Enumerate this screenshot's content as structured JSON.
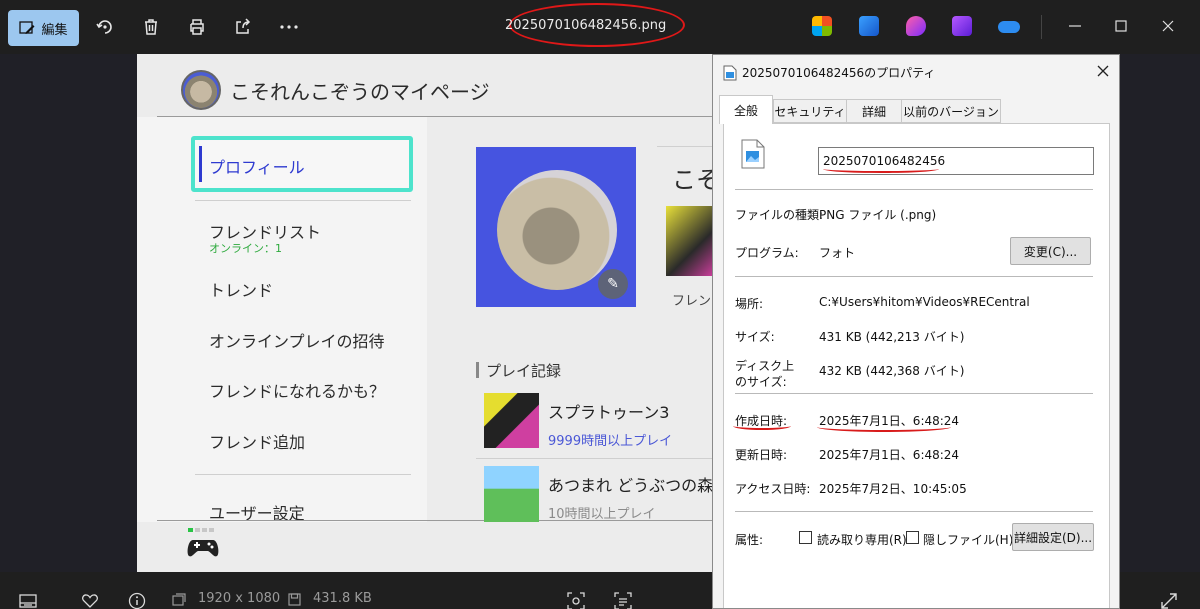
{
  "toolbar": {
    "edit_label": "編集",
    "file_name": "2025070106482456.png"
  },
  "bottombar": {
    "dimensions": "1920 x 1080",
    "file_size": "431.8 KB"
  },
  "canvas": {
    "page_title": "こそれんこぞうのマイページ",
    "menu": {
      "selected": "プロフィール",
      "friend_list": "フレンドリスト",
      "online_count": "オンライン：1",
      "trend": "トレンド",
      "online_invite": "オンラインプレイの招待",
      "maybe_friends": "フレンドになれるかも？",
      "add_friend": "フレンド追加",
      "user_settings": "ユーザー設定"
    },
    "profile_name_cut": "こそ",
    "friend_label_cut": "フレン",
    "play_record_title": "プレイ記録",
    "games": [
      {
        "name": "スプラトゥーン3",
        "time": "9999時間以上プレイ",
        "time_color": "#4a57d6"
      },
      {
        "name": "あつまれ どうぶつの森",
        "time": "10時間以上プレイ",
        "time_color": "#8a8a8a"
      }
    ]
  },
  "dialog": {
    "title": "2025070106482456のプロパティ",
    "tabs": [
      "全般",
      "セキュリティ",
      "詳細",
      "以前のバージョン"
    ],
    "file_name_value": "2025070106482456",
    "file_type_label": "ファイルの種類:",
    "file_type_value": "PNG ファイル (.png)",
    "program_label": "プログラム:",
    "program_value": "フォト",
    "change_button": "変更(C)...",
    "location_label": "場所:",
    "location_value": "C:¥Users¥hitom¥Videos¥RECentral",
    "size_label": "サイズ:",
    "size_value": "431 KB (442,213 バイト)",
    "disk_size_label_1": "ディスク上",
    "disk_size_label_2": "のサイズ:",
    "disk_size_value": "432 KB (442,368 バイト)",
    "created_label": "作成日時:",
    "created_value": "2025年7月1日、6:48:24",
    "modified_label": "更新日時:",
    "modified_value": "2025年7月1日、6:48:24",
    "accessed_label": "アクセス日時:",
    "accessed_value": "2025年7月2日、10:45:05",
    "attributes_label": "属性:",
    "readonly_label": "読み取り専用(R)",
    "hidden_label": "隠しファイル(H)",
    "advanced_button": "詳細設定(D)..."
  },
  "colors": {
    "annotation_red": "#e01818",
    "selection_teal": "#4de3cc",
    "accent_blue": "#2e3ad0"
  }
}
